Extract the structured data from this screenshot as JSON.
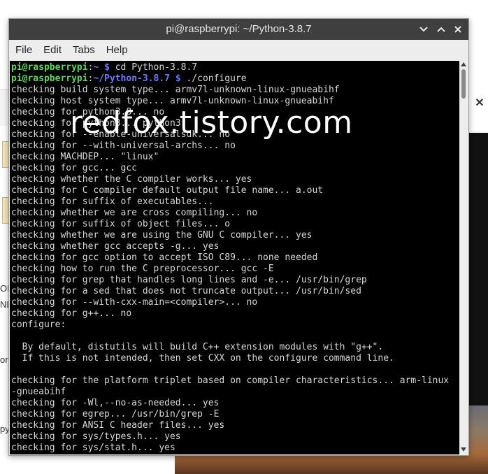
{
  "window": {
    "title": "pi@raspberrypi: ~/Python-3.8.7"
  },
  "menu": [
    "File",
    "Edit",
    "Tabs",
    "Help"
  ],
  "prompt": {
    "user": "pi@raspberrypi",
    "sep": ":",
    "path1": "~",
    "path2": "~/Python-3.8.7",
    "symbol": "$",
    "cmd1": " cd Python-3.8.7",
    "cmd2": " ./configure"
  },
  "output": [
    "checking build system type... armv7l-unknown-linux-gnueabihf",
    "checking host system type... armv7l-unknown-linux-gnueabihf",
    "checking for python3.8... no",
    "checking for python3... python3",
    "checking for --enable-universalsdk... no",
    "checking for --with-universal-archs... no",
    "checking MACHDEP... \"linux\"",
    "checking for gcc... gcc",
    "checking whether the C compiler works... yes",
    "checking for C compiler default output file name... a.out",
    "checking for suffix of executables... ",
    "checking whether we are cross compiling... no",
    "checking for suffix of object files... o",
    "checking whether we are using the GNU C compiler... yes",
    "checking whether gcc accepts -g... yes",
    "checking for gcc option to accept ISO C89... none needed",
    "checking how to run the C preprocessor... gcc -E",
    "checking for grep that handles long lines and -e... /usr/bin/grep",
    "checking for a sed that does not truncate output... /usr/bin/sed",
    "checking for --with-cxx-main=<compiler>... no",
    "checking for g++... no",
    "configure:",
    "",
    "  By default, distutils will build C++ extension modules with \"g++\".",
    "  If this is not intended, then set CXX on the configure command line.",
    "",
    "checking for the platform triplet based on compiler characteristics... arm-linux",
    "-gnueabihf",
    "checking for -Wl,--no-as-needed... yes",
    "checking for egrep... /usr/bin/grep -E",
    "checking for ANSI C header files... yes",
    "checking for sys/types.h... yes",
    "checking for sys/stat.h... yes"
  ],
  "watermark": "redfox.tistory.com",
  "background": {
    "text1": "OI",
    "text2": "ND",
    "text3": "on",
    "text4": "py"
  }
}
